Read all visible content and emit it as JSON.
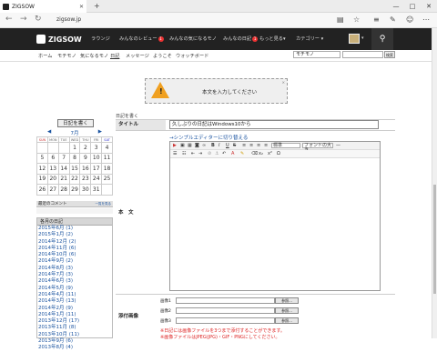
{
  "browser": {
    "tab_title": "ZIGSOW",
    "url": "zigsow.jp",
    "window_controls": [
      "—",
      "□",
      "✕"
    ]
  },
  "site": {
    "logo": "ZIGSOW",
    "nav": [
      {
        "label": "ラウンジ"
      },
      {
        "label": "みんなのレビュー",
        "badge": "1"
      },
      {
        "label": "みんなの気になるモノ"
      },
      {
        "label": "みんなの日記",
        "badge": "1"
      },
      {
        "label": "もっと見る▾"
      },
      {
        "label": "カテゴリー ▾"
      }
    ],
    "subnav": [
      "ホーム",
      "モチモノ",
      "気になるモノ",
      "日記",
      "メッセージ",
      "ようこそ",
      "ウォッチボード"
    ],
    "search_scope": "モチモノ",
    "search_button": "検索"
  },
  "alert": {
    "message": "本文を入力してください",
    "close": "×"
  },
  "sidebar": {
    "write_button": "日記を書く",
    "month": "7月",
    "prev": "◀",
    "next": "▶",
    "weekdays": [
      "SUN",
      "MON",
      "TUE",
      "WED",
      "THU",
      "FRI",
      "SAT"
    ],
    "weeks": [
      [
        "",
        "",
        "",
        "1",
        "2",
        "3",
        "4"
      ],
      [
        "5",
        "6",
        "7",
        "8",
        "9",
        "10",
        "11"
      ],
      [
        "12",
        "13",
        "14",
        "15",
        "16",
        "17",
        "18"
      ],
      [
        "19",
        "20",
        "21",
        "22",
        "23",
        "24",
        "25"
      ],
      [
        "26",
        "27",
        "28",
        "29",
        "30",
        "31",
        ""
      ]
    ],
    "recent_comments": "最近のコメント",
    "more_link": "一覧を見る",
    "archive_title": "各月の日記",
    "archive": [
      "2015年6月 (1)",
      "2015年1月 (2)",
      "2014年12月 (2)",
      "2014年11月 (6)",
      "2014年10月 (6)",
      "2014年9月 (2)",
      "2014年8月 (3)",
      "2014年7月 (3)",
      "2014年6月 (3)",
      "2014年5月 (9)",
      "2014年4月 (11)",
      "2014年3月 (13)",
      "2014年2月 (9)",
      "2014年1月 (11)",
      "2013年12月 (17)",
      "2013年11月 (8)",
      "2013年10月 (11)",
      "2013年9月 (6)",
      "2013年8月 (4)"
    ]
  },
  "form": {
    "breadcrumb": "日記を書く",
    "title_label": "タイトル",
    "title_value": "久しぶりの日記はWindows10から",
    "simple_editor_link": "→シンプルエディターに切り替える",
    "body_label": "本　文",
    "paragraph_select": "標準",
    "font_select": "フォントの大き",
    "attach_label": "添付画像",
    "files": [
      "画像1",
      "画像2",
      "画像3"
    ],
    "browse": "参照...",
    "note1": "※日記には画像ファイルを3つまで添付することができます。",
    "note2": "※画像ファイルはJPEG(JPG)・GIF・PNGにしてください。"
  }
}
